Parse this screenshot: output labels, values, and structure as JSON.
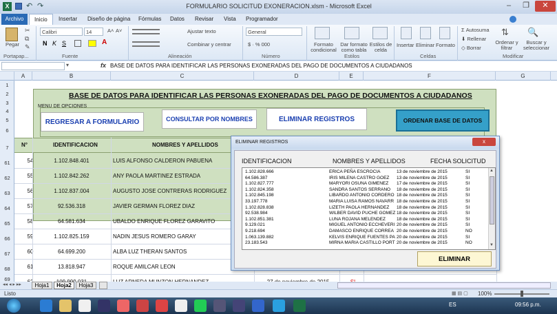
{
  "window": {
    "title": "FORMULARIO SOLICITUD EXONERACION.xlsm - Microsoft Excel"
  },
  "tabs": [
    "Archivo",
    "Inicio",
    "Insertar",
    "Diseño de página",
    "Fórmulas",
    "Datos",
    "Revisar",
    "Vista",
    "Programador"
  ],
  "ribbon": {
    "paste": "Pegar",
    "font_name": "Calibri",
    "font_size": "14",
    "wrap": "Ajustar texto",
    "merge": "Combinar y centrar",
    "number_format": "General",
    "cond_format": "Formato condicional",
    "table_format": "Dar formato como tabla",
    "cell_styles": "Estilos de celda",
    "insert": "Insertar",
    "delete": "Eliminar",
    "format": "Formato",
    "autosum": "Autosuma",
    "fill": "Rellenar",
    "clear": "Borrar",
    "sort": "Ordenar y filtrar",
    "find": "Buscar y seleccionar",
    "groups": {
      "clipboard": "Portapap...",
      "font": "Fuente",
      "alignment": "Alineación",
      "number": "Número",
      "styles": "Estilos",
      "cells": "Celdas",
      "modify": "Modificar"
    }
  },
  "formula_bar": {
    "cell_ref": "",
    "fx": "fx",
    "content": "BASE DE DATOS PARA IDENTIFICAR LAS PERSONAS EXONERADAS DEL PAGO DE DOCUMENTOS A CIUDADANOS"
  },
  "columns": [
    "A",
    "B",
    "C",
    "D",
    "E",
    "F",
    "G"
  ],
  "rows": [
    "1",
    "2",
    "3",
    "4",
    "5",
    "6",
    "7",
    "61",
    "62",
    "63",
    "64",
    "65",
    "66",
    "67",
    "68",
    "69"
  ],
  "sheet": {
    "heading": "BASE DE DATOS PARA IDENTIFICAR LAS PERSONAS EXONERADAS DEL PAGO DE DOCUMENTOS A CIUDADANOS",
    "menu_label": "MENU DE OPCIONES",
    "btn_back": "REGRESAR A FORMULARIO",
    "btn_consult": "CONSULTAR POR NOMBRES",
    "btn_delete": "ELIMINAR REGISTROS",
    "btn_sort": "ORDENAR BASE DE DATOS",
    "col_no": "N°",
    "col_id": "IDENTIFICACION",
    "col_name": "NOMBRES Y APELLIDOS",
    "data": [
      {
        "n": "54",
        "id": "1.102.848.401",
        "name": "LUIS ALFONSO CALDERON PABUENA"
      },
      {
        "n": "55",
        "id": "1.102.842.262",
        "name": "ANY PAOLA MARTINEZ ESTRADA"
      },
      {
        "n": "56",
        "id": "1.102.837.004",
        "name": "AUGUSTO JOSE CONTRERAS RODRIGUEZ"
      },
      {
        "n": "57",
        "id": "92.536.318",
        "name": "JAVIER GERMAN FLOREZ DIAZ"
      },
      {
        "n": "58",
        "id": "64.581.634",
        "name": "UBALDO ENRIQUE FLOREZ GARAVITO"
      },
      {
        "n": "59",
        "id": "1.102.825.159",
        "name": "NADIN JESUS ROMERO GARAY"
      },
      {
        "n": "60",
        "id": "64.699.200",
        "name": "ALBA LUZ THERAN SANTOS"
      },
      {
        "n": "61",
        "id": "13.818.947",
        "name": "ROQUE AMILCAR LEON"
      },
      {
        "n": "62",
        "id": "109.999.031",
        "name": "LUZ ARNEDA MUNZON HERNANDEZ",
        "date": "27 de noviembre de 2015",
        "flag": "SI"
      }
    ]
  },
  "dialog": {
    "title": "ELIMINAR REGISTROS",
    "close": "x",
    "h_id": "IDENTIFICACION",
    "h_name": "NOMBRES Y APELLIDOS",
    "h_date": "FECHA SOLICITUD",
    "rows": [
      [
        "1.102.828.666",
        "ERICA PEÑA ESCROCIA",
        "13 de noviembre de 2015",
        "SI"
      ],
      [
        "64.586.387",
        "IRIS MILENA CASTRO GOEZ",
        "13 de noviembre de 2015",
        "SI"
      ],
      [
        "1.102.827.777",
        "MARYORI OSUNA GIMENEZ",
        "17 de noviembre de 2015",
        "SI"
      ],
      [
        "1.102.824.358",
        "SANDRA SANTOS SERRANO",
        "18 de noviembre de 2015",
        "SI"
      ],
      [
        "1.102.845.198",
        "LIBARDO ANTONIO CORDERO",
        "18 de noviembre de 2015",
        "SI"
      ],
      [
        "33.197.778",
        "MARIA LUISA RAMOS NAVARR",
        "18 de noviembre de 2015",
        "SI"
      ],
      [
        "1.102.828.838",
        "LIZETH PAOLA HERNANDEZ",
        "18 de noviembre de 2015",
        "SI"
      ],
      [
        "92.538.984",
        "WILBER DAVID PUCHE GOMEZ",
        "18 de noviembre de 2015",
        "SI"
      ],
      [
        "1.102.851.381",
        "LUNA ROJANA MELENDEZ",
        "18 de noviembre de 2015",
        "SI"
      ],
      [
        "9.129.021",
        "MIGUEL ANTONIO ECCHEVERI",
        "20 de noviembre de 2015",
        "SI"
      ],
      [
        "9.218.694",
        "DAMASCO ENRIQUE CORREA",
        "20 de noviembre de 2015",
        "NO"
      ],
      [
        "1.063.139.882",
        "KELVIS ENRIQUE FUENTES PA",
        "20 de noviembre de 2015",
        "SI"
      ],
      [
        "23.183.543",
        "MIRNA MARIA CASTILLO PORT",
        "20 de noviembre de 2015",
        "NO"
      ]
    ],
    "btn": "ELIMINAR"
  },
  "sheet_tabs": [
    "Hoja1",
    "Hoja2",
    "Hoja3"
  ],
  "status": {
    "ready": "Listo",
    "zoom": "100%"
  },
  "taskbar": {
    "lang": "ES",
    "time": "09:56 p.m."
  }
}
